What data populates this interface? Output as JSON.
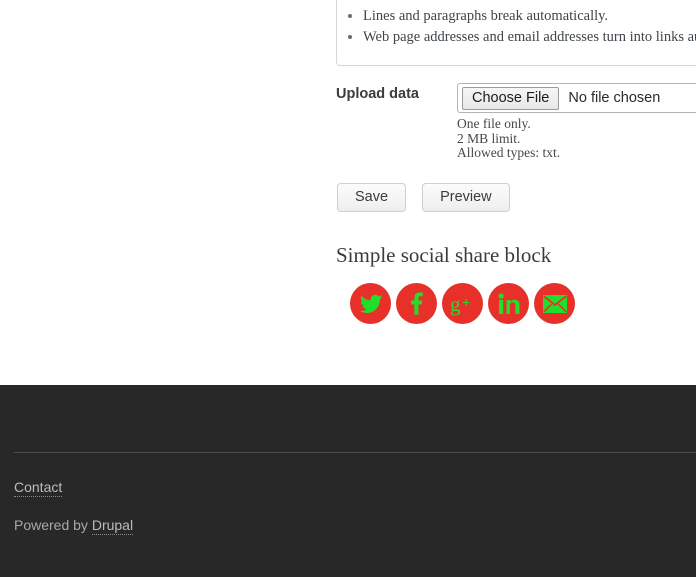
{
  "filter_tips": {
    "items": [
      "Lines and paragraphs break automatically.",
      "Web page addresses and email addresses turn into links automatically."
    ]
  },
  "upload": {
    "label": "Upload data",
    "choose_file_label": "Choose File",
    "file_status": "No file chosen",
    "description": [
      "One file only.",
      "2 MB limit.",
      "Allowed types: txt."
    ]
  },
  "actions": {
    "save_label": "Save",
    "preview_label": "Preview"
  },
  "social_share": {
    "heading": "Simple social share block",
    "icon_bg": "#e8302a",
    "icon_fg": "#22dd2a",
    "icons": [
      {
        "name": "twitter-icon",
        "label": "Twitter"
      },
      {
        "name": "facebook-icon",
        "label": "Facebook"
      },
      {
        "name": "google-plus-icon",
        "label": "Google Plus"
      },
      {
        "name": "linkedin-icon",
        "label": "LinkedIn"
      },
      {
        "name": "email-icon",
        "label": "Email"
      }
    ]
  },
  "footer": {
    "background": "#282828",
    "contact_label": "Contact",
    "powered_by_prefix": "Powered by ",
    "powered_by_link": "Drupal"
  }
}
